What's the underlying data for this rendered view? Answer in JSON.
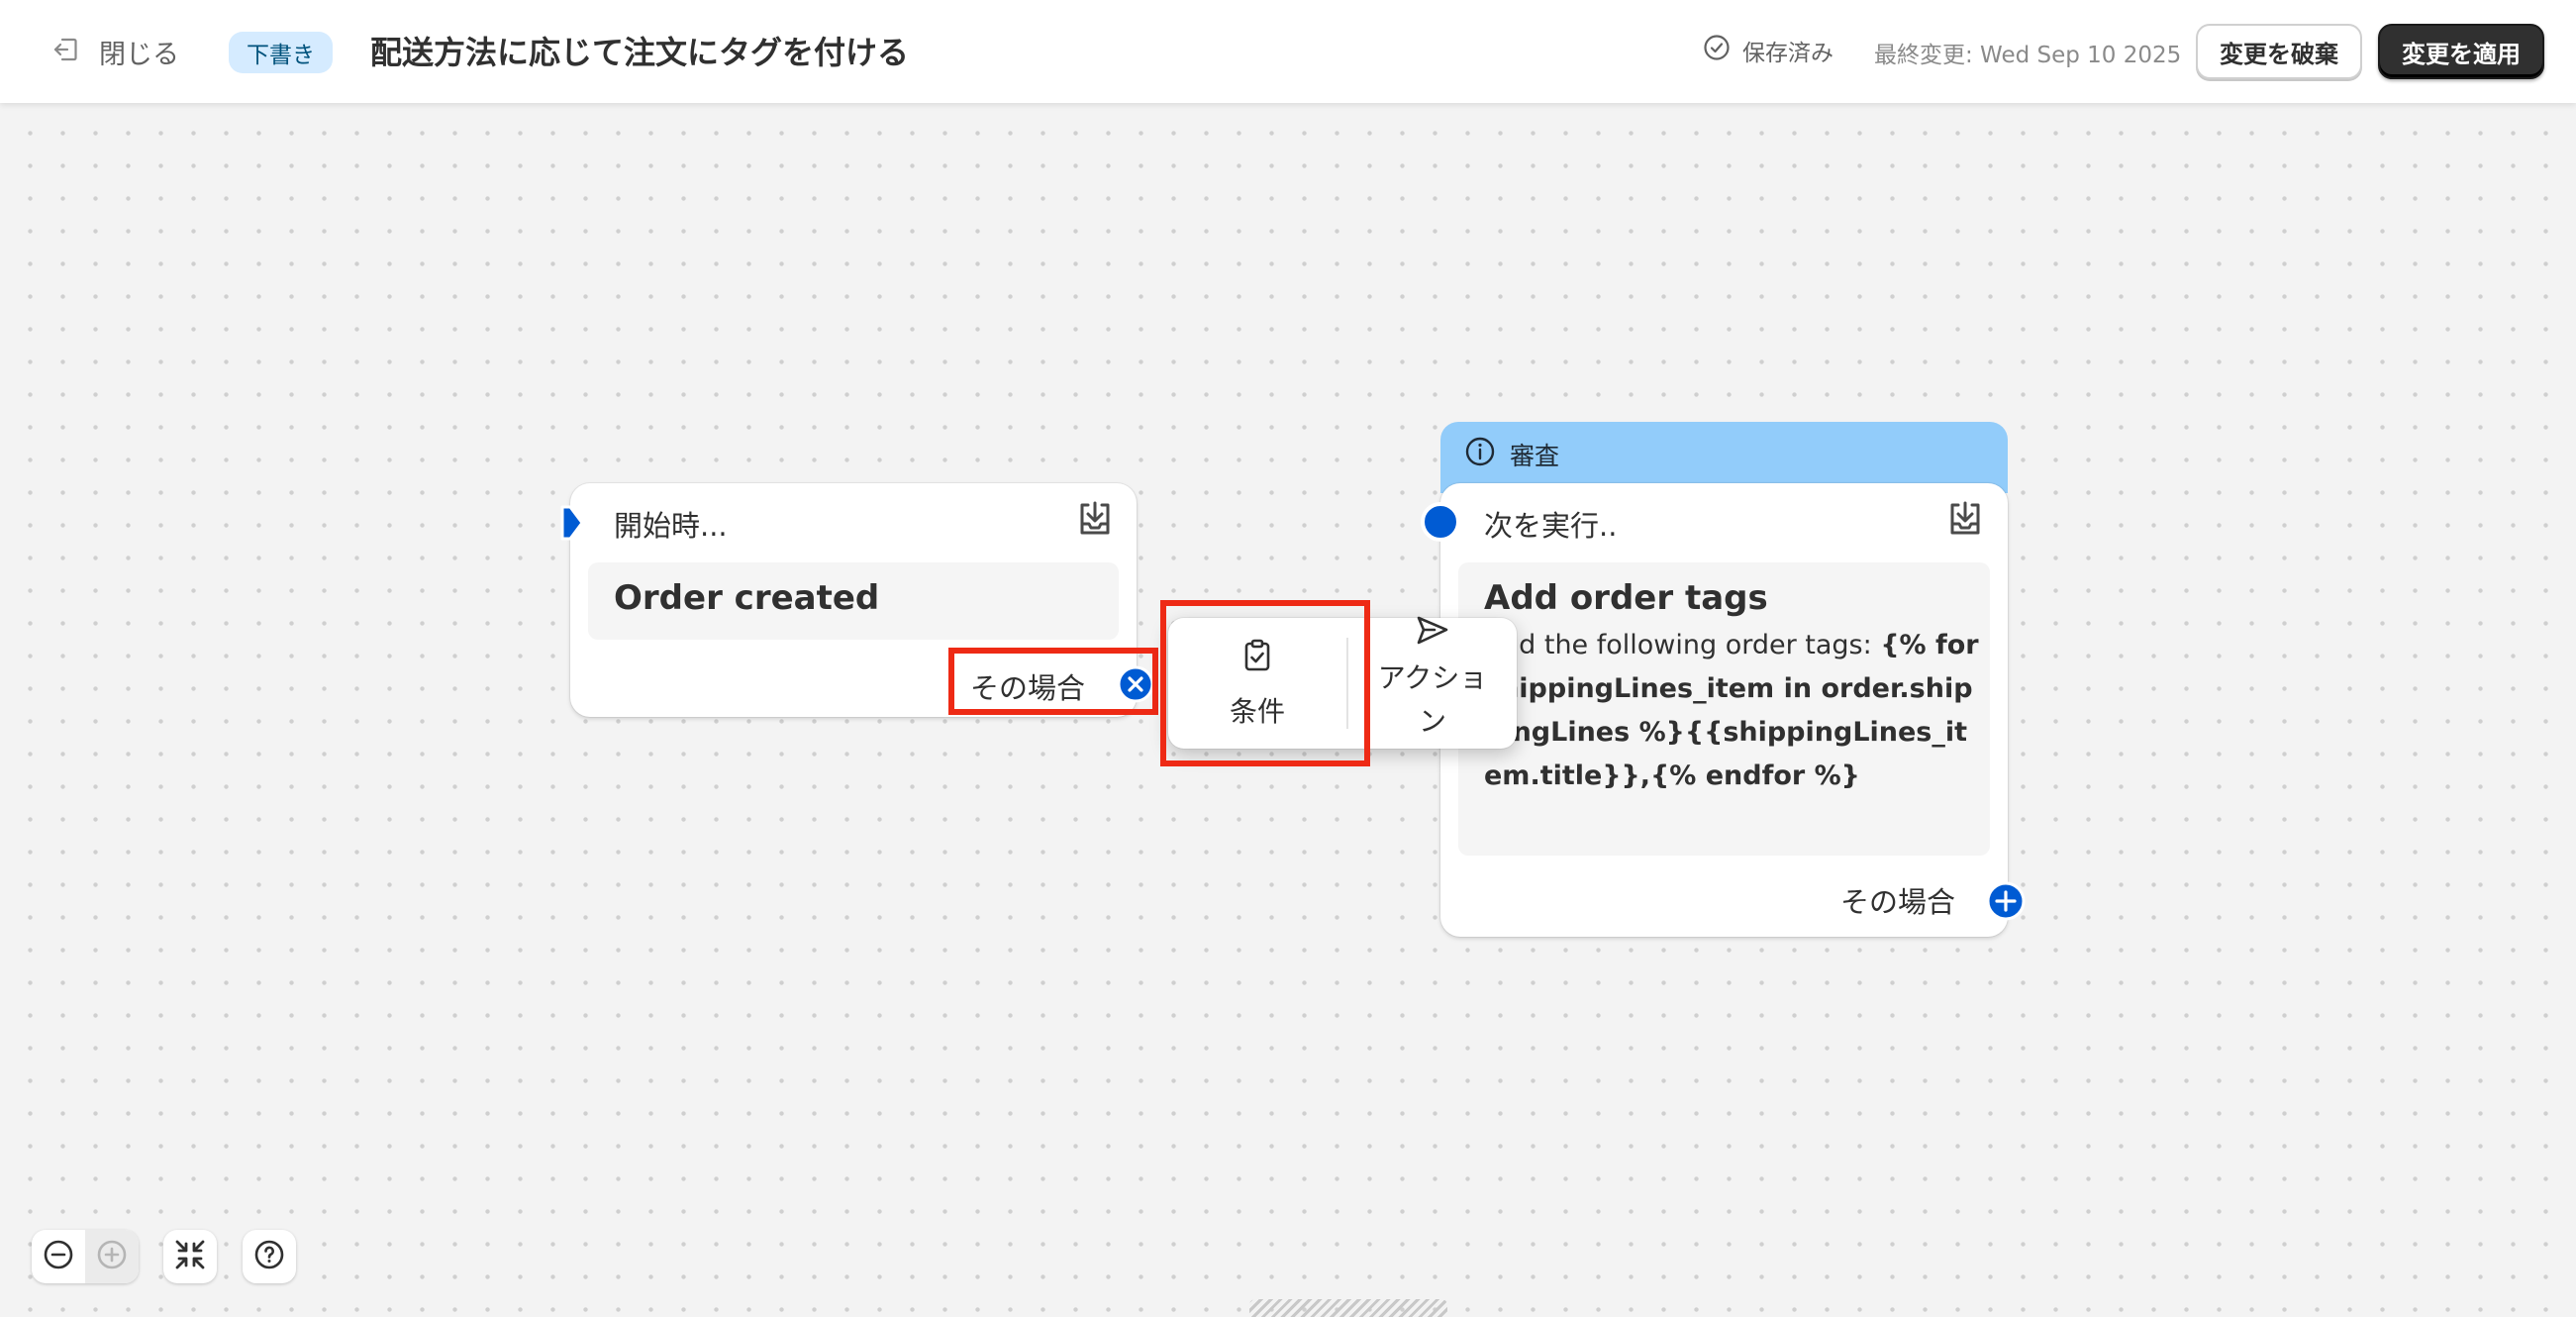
{
  "header": {
    "close_label": "閉じる",
    "status_badge": "下書き",
    "workflow_title": "配送方法に応じて注文にタグを付ける",
    "saved_label": "保存済み",
    "last_modified": "最終変更: Wed Sep 10 2025",
    "discard_label": "変更を破棄",
    "apply_label": "変更を適用"
  },
  "trigger_node": {
    "header": "開始時...",
    "title": "Order created",
    "then_label": "その場合"
  },
  "action_node": {
    "review_label": "審査",
    "header": "次を実行..",
    "title": "Add order tags",
    "desc_plain_1": "Add the following order tags: ",
    "desc_code": "{% for shippingLines_item in order.shippingLines %}{{shippingLines_item.title}},{% endfor %}",
    "then_label": "その場合"
  },
  "popup": {
    "condition_label": "条件",
    "action_label": "アクション"
  },
  "colors": {
    "accent": "#005bd3",
    "highlight": "#ee2a15",
    "review": "#92ccfa",
    "primary_button": "#303030"
  },
  "icons": {
    "close": "exit-icon",
    "saved": "check-circle-icon",
    "download": "download-icon",
    "info": "info-icon",
    "condition": "clipboard-check-icon",
    "action": "send-icon",
    "zoom_out": "minus-circle-icon",
    "zoom_in": "plus-circle-icon",
    "fit": "collapse-icon",
    "help": "help-icon"
  }
}
